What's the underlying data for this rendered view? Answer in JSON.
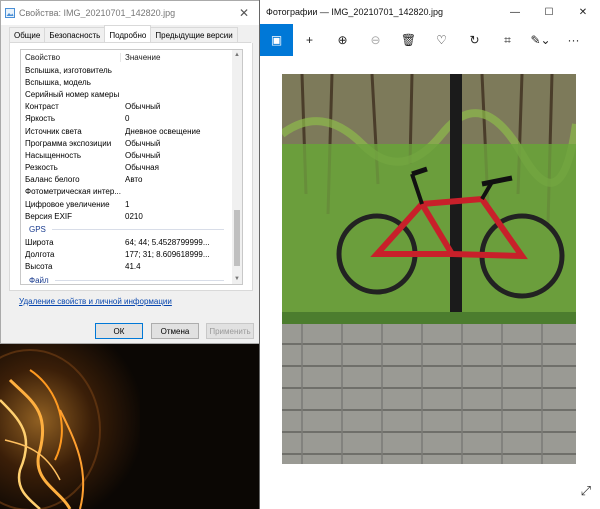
{
  "properties_dialog": {
    "title": "Свойства: IMG_20210701_142820.jpg",
    "close_glyph": "✕",
    "tabs": [
      {
        "label": "Общие"
      },
      {
        "label": "Безопасность"
      },
      {
        "label": "Подробно"
      },
      {
        "label": "Предыдущие версии"
      }
    ],
    "columns": {
      "property": "Свойство",
      "value": "Значение"
    },
    "rows": [
      {
        "property": "Вспышка, изготовитель",
        "value": ""
      },
      {
        "property": "Вспышка, модель",
        "value": ""
      },
      {
        "property": "Серийный номер камеры",
        "value": ""
      },
      {
        "property": "Контраст",
        "value": "Обычный"
      },
      {
        "property": "Яркость",
        "value": "0"
      },
      {
        "property": "Источник света",
        "value": "Дневное освещение"
      },
      {
        "property": "Программа экспозиции",
        "value": "Обычный"
      },
      {
        "property": "Насыщенность",
        "value": "Обычный"
      },
      {
        "property": "Резкость",
        "value": "Обычная"
      },
      {
        "property": "Баланс белого",
        "value": "Авто"
      },
      {
        "property": "Фотометрическая интер...",
        "value": ""
      },
      {
        "property": "Цифровое увеличение",
        "value": "1"
      },
      {
        "property": "Версия EXIF",
        "value": "0210"
      }
    ],
    "gps_group": "GPS",
    "gps_rows": [
      {
        "property": "Широта",
        "value": "64; 44; 5.4528799999..."
      },
      {
        "property": "Долгота",
        "value": "177; 31; 8.609618999..."
      },
      {
        "property": "Высота",
        "value": "41.4"
      }
    ],
    "file_group": "Файл",
    "remove_link": "Удаление свойств и личной информации",
    "buttons": {
      "ok": "ОК",
      "cancel": "Отмена",
      "apply": "Применить"
    }
  },
  "photos_window": {
    "title": "Фотографии — IMG_20210701_142820.jpg",
    "window_controls": {
      "minimize": "—",
      "maximize": "☐",
      "close": "✕"
    },
    "toolbar": [
      {
        "name": "view-icon",
        "glyph": "▣",
        "selected": true
      },
      {
        "name": "add-icon",
        "glyph": "+",
        "selected": false
      },
      {
        "name": "zoom-in-icon",
        "glyph": "⊕",
        "selected": false
      },
      {
        "name": "zoom-out-icon",
        "glyph": "⊖",
        "selected": false,
        "disabled": true
      },
      {
        "name": "delete-icon",
        "glyph": "🗑",
        "selected": false
      },
      {
        "name": "favorite-icon",
        "glyph": "♡",
        "selected": false
      },
      {
        "name": "rotate-icon",
        "glyph": "↻",
        "selected": false
      },
      {
        "name": "crop-icon",
        "glyph": "⌗",
        "selected": false
      },
      {
        "name": "edit-icon",
        "glyph": "✎⌄",
        "selected": false
      },
      {
        "name": "more-icon",
        "glyph": "···",
        "selected": false
      }
    ],
    "expand_glyph": "⤢"
  },
  "colors": {
    "accent": "#0078d7",
    "link": "#0645ad",
    "group": "#1a3c8f"
  }
}
